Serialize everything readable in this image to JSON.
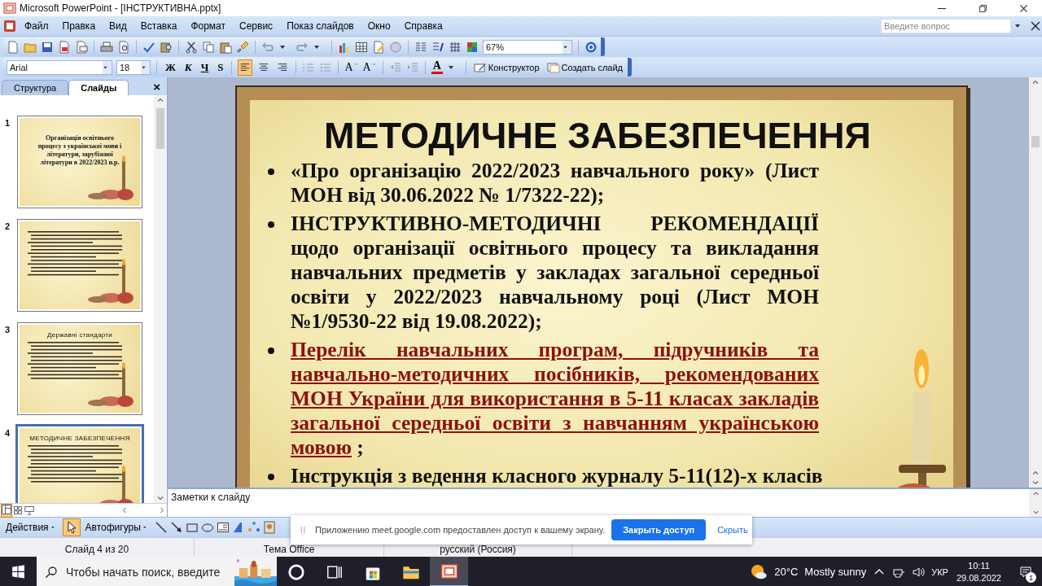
{
  "window": {
    "title": "Microsoft PowerPoint - [ІНСТРУКТИВНА.pptx]"
  },
  "menu": [
    "Файл",
    "Правка",
    "Вид",
    "Вставка",
    "Формат",
    "Сервис",
    "Показ слайдов",
    "Окно",
    "Справка"
  ],
  "help_field": {
    "placeholder": "Введите вопрос"
  },
  "standard_toolbar": {
    "zoom": "67%"
  },
  "format_toolbar": {
    "font": "Arial",
    "size": "18",
    "styles": [
      "Ж",
      "К",
      "Ч",
      "S"
    ],
    "alignment": [
      {
        "selected": true
      },
      {
        "selected": false
      },
      {
        "selected": false
      }
    ],
    "font_grow": "A",
    "font_shrink": "A",
    "font_color": "A",
    "design": "Конструктор",
    "new_slide": "Создать слайд"
  },
  "pane_tabs": [
    {
      "label": "Структура",
      "selected": false
    },
    {
      "label": "Слайды",
      "selected": true
    }
  ],
  "pane_close": "×",
  "thumbnails": [
    {
      "number": "1",
      "kind": "title",
      "title": "Організація освітнього процесу з української мови і літератури, зарубіжної літератури в 2022/2023 н.р.",
      "selected": false
    },
    {
      "number": "2",
      "kind": "text",
      "selected": false
    },
    {
      "number": "3",
      "kind": "content",
      "title": "Державні стандарти",
      "selected": false
    },
    {
      "number": "4",
      "kind": "content",
      "title": "МЕТОДИЧНЕ ЗАБЕЗПЕЧЕННЯ",
      "selected": true
    }
  ],
  "slide": {
    "title": "МЕТОДИЧНЕ ЗАБЕЗПЕЧЕННЯ",
    "bullets": [
      {
        "text": "«Про організацію 2022/2023 навчального  року» (Лист МОН від 30.06.2022 № 1/7322-22);",
        "link": false
      },
      {
        "text": "ІНСТРУКТИВНО-МЕТОДИЧНІ РЕКОМЕНДАЦІЇ щодо організації освітнього процесу та викладання навчальних предметів у закладах загальної середньої освіти у 2022/2023 навчальному році (Лист МОН №1/9530-22 від 19.08.2022);",
        "link": false
      },
      {
        "text": "Перелік навчальних програм, підручників та навчально-методичних посібників, рекомендованих МОН України для використання в 5-11 класах закладів загальної середньої освіти з навчанням українською мовою",
        "link": true,
        "suffix": " ;"
      },
      {
        "text": "Інструкція з ведення класного журналу 5-11(12)-х класів",
        "link": false
      }
    ]
  },
  "notes": {
    "placeholder": "Заметки к слайду"
  },
  "drawing_toolbar": {
    "actions": "Действия",
    "autoshapes": "Автофигуры"
  },
  "status_bar": [
    "Слайд 4 из 20",
    "Тема Office",
    "русский (Россия)"
  ],
  "share_popup": {
    "message": "Приложению meet.google.com предоставлен доступ к вашему экрану.",
    "stop": "Закрыть доступ",
    "hide": "Скрыть"
  },
  "taskbar": {
    "search": {
      "placeholder": "Чтобы начать поиск, введите"
    },
    "apps": [
      {
        "selected": false
      },
      {
        "selected": false
      },
      {
        "selected": false
      },
      {
        "selected": false
      },
      {
        "selected": true
      }
    ],
    "temperature": "20°C",
    "weather": "Mostly sunny",
    "language": "УКР",
    "time": "10:11",
    "date": "29.08.2022",
    "notifications": "1"
  }
}
